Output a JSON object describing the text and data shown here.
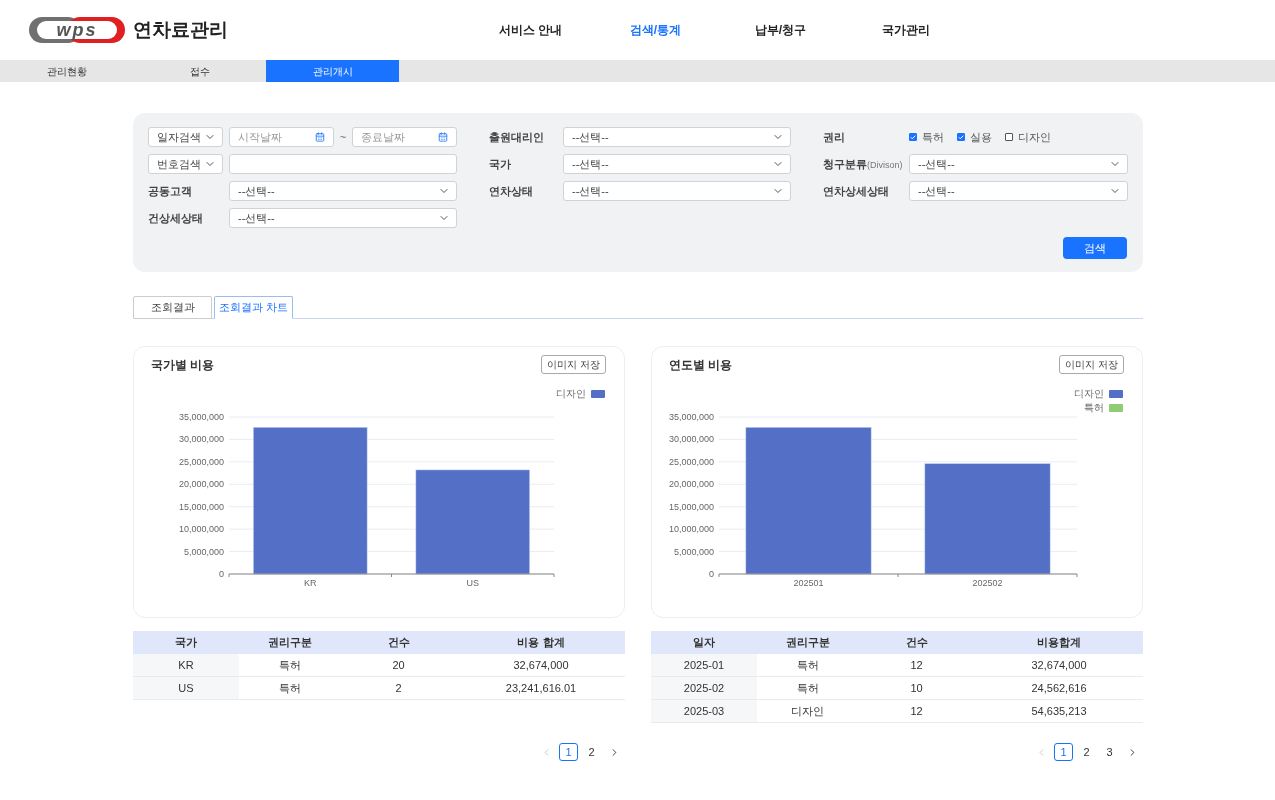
{
  "header": {
    "logo_text": "wps",
    "app_title": "연차료관리",
    "nav": [
      {
        "label": "서비스 안내",
        "selected": false
      },
      {
        "label": "검색/통계",
        "selected": true
      },
      {
        "label": "납부/청구",
        "selected": false
      },
      {
        "label": "국가관리",
        "selected": false
      }
    ]
  },
  "subnav": [
    {
      "label": "관리현황",
      "selected": false
    },
    {
      "label": "접수",
      "selected": false
    },
    {
      "label": "관리개시",
      "selected": true
    }
  ],
  "filters": [
    {
      "kind": "date_range",
      "selector": "일자검색",
      "start_placeholder": "시작날짜",
      "separator": "~",
      "end_placeholder": "종료날짜"
    },
    {
      "kind": "select",
      "label": "출원대리인",
      "value": "--선택--"
    },
    {
      "kind": "checks",
      "label": "권리",
      "options": [
        {
          "label": "특허",
          "checked": true
        },
        {
          "label": "실용",
          "checked": true
        },
        {
          "label": "디자인",
          "checked": false
        }
      ]
    },
    {
      "kind": "text_search",
      "selector": "번호검색"
    },
    {
      "kind": "select",
      "label": "국가",
      "value": "--선택--"
    },
    {
      "kind": "select",
      "label": "청구분류",
      "label_note": "(Divison)",
      "value": "--선택--"
    },
    {
      "kind": "select",
      "label": "공동고객",
      "value": "--선택--"
    },
    {
      "kind": "select",
      "label": "연차상태",
      "value": "--선택--"
    },
    {
      "kind": "select",
      "label": "연차상세상태",
      "value": "--선택--"
    },
    {
      "kind": "select",
      "label": "건상세상태",
      "value": "--선택--"
    }
  ],
  "search_button": "검색",
  "result_tabs": [
    {
      "label": "조회결과",
      "selected": false
    },
    {
      "label": "조회결과 차트",
      "selected": true
    }
  ],
  "panels": [
    {
      "title": "국가별 비용",
      "save_button": "이미지 저장",
      "chart_data": {
        "type": "bar",
        "categories": [
          "KR",
          "US"
        ],
        "series": [
          {
            "name": "디자인",
            "color": "#5470c6",
            "values": [
              32700000,
              23200000
            ]
          }
        ],
        "grid": true,
        "ylim": [
          0,
          35000000
        ],
        "yticks": [
          {
            "value": 0,
            "label": "0"
          },
          {
            "value": 5000000,
            "label": "5,000,000"
          },
          {
            "value": 10000000,
            "label": "10,000,000"
          },
          {
            "value": 15000000,
            "label": "15,000,000"
          },
          {
            "value": 20000000,
            "label": "20,000,000"
          },
          {
            "value": 25000000,
            "label": "25,000,000"
          },
          {
            "value": 30000000,
            "label": "30,000,000"
          },
          {
            "value": 35000000,
            "label": "35,000,000"
          }
        ]
      },
      "table": {
        "columns": [
          "국가",
          "권리구분",
          "건수",
          "비용 합계"
        ],
        "rows": [
          [
            "KR",
            "특허",
            "20",
            "32,674,000"
          ],
          [
            "US",
            "특허",
            "2",
            "23,241,616.01"
          ]
        ]
      },
      "pagination": {
        "prev_disabled": true,
        "next_disabled": false,
        "pages": [
          {
            "label": "1",
            "selected": true
          },
          {
            "label": "2",
            "selected": false
          }
        ]
      }
    },
    {
      "title": "연도별 비용",
      "save_button": "이미지 저장",
      "chart_data": {
        "type": "bar",
        "categories": [
          "202501",
          "202502"
        ],
        "series": [
          {
            "name": "디자인",
            "color": "#5470c6",
            "values": [
              32700000,
              24600000
            ]
          },
          {
            "name": "특허",
            "color": "#91cc75",
            "values": [
              null,
              null
            ]
          }
        ],
        "grid": true,
        "ylim": [
          0,
          35000000
        ],
        "yticks": [
          {
            "value": 0,
            "label": "0"
          },
          {
            "value": 5000000,
            "label": "5,000,000"
          },
          {
            "value": 10000000,
            "label": "10,000,000"
          },
          {
            "value": 15000000,
            "label": "15,000,000"
          },
          {
            "value": 20000000,
            "label": "20,000,000"
          },
          {
            "value": 25000000,
            "label": "25,000,000"
          },
          {
            "value": 30000000,
            "label": "30,000,000"
          },
          {
            "value": 35000000,
            "label": "35,000,000"
          }
        ]
      },
      "table": {
        "columns": [
          "일자",
          "권리구분",
          "건수",
          "비용합계"
        ],
        "rows": [
          [
            "2025-01",
            "특허",
            "12",
            "32,674,000"
          ],
          [
            "2025-02",
            "특허",
            "10",
            "24,562,616"
          ],
          [
            "2025-03",
            "디자인",
            "12",
            "54,635,213"
          ]
        ]
      },
      "pagination": {
        "prev_disabled": true,
        "next_disabled": false,
        "pages": [
          {
            "label": "1",
            "selected": true
          },
          {
            "label": "2",
            "selected": false
          },
          {
            "label": "3",
            "selected": false
          }
        ]
      }
    }
  ]
}
